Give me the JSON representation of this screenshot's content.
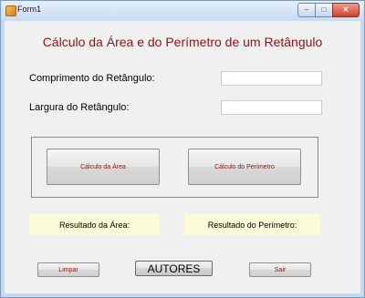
{
  "window": {
    "title": "Form1",
    "controls": {
      "minimize": "–",
      "maximize": "□",
      "close": "✕"
    }
  },
  "form": {
    "heading": "Cálculo da Área e do Perímetro de um Retângulo",
    "length_label": "Comprimento do Retângulo:",
    "length_value": "",
    "width_label": "Largura do Retângulo:",
    "width_value": "",
    "area_button": "Cálculo da Área",
    "perimeter_button": "Cálculo do Perímetro",
    "area_result": "Resultado da Área:",
    "perimeter_result": "Resultado do Perímetro:",
    "clear_button": "Limpar",
    "authors_button": "AUTORES",
    "exit_button": "Sair"
  },
  "colors": {
    "accent_text": "#8b1414",
    "result_bg": "#fcfbd7",
    "form_bg": "#f0f0f0",
    "frame": "#c4d8ef"
  },
  "icons": {
    "app": "form-app-icon"
  }
}
